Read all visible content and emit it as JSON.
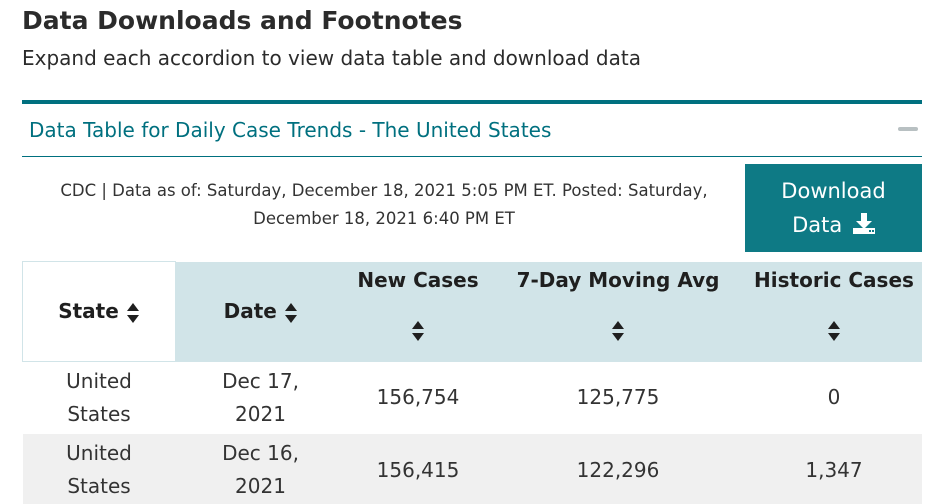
{
  "header": {
    "title": "Data Downloads and Footnotes",
    "subtitle": "Expand each accordion to view data table and download data"
  },
  "accordion": {
    "title": "Data Table for Daily Case Trends - The United States",
    "meta_line1": "CDC | Data as of: Saturday, December 18, 2021 5:05 PM ET. Posted: Saturday,",
    "meta_line2": "December 18, 2021 6:40 PM ET",
    "download_line1": "Download",
    "download_line2": "Data",
    "icons": {
      "collapse": "minus-icon",
      "download": "download-icon",
      "sort": "sort-icon"
    },
    "colors": {
      "accent": "#00707f",
      "button": "#0e7a85",
      "header_bg": "#d1e4e8",
      "alt_row_bg": "#f0f0f0"
    }
  },
  "table": {
    "columns": [
      "State",
      "Date",
      "New Cases",
      "7-Day Moving Avg",
      "Historic Cases"
    ],
    "rows": [
      {
        "state_1": "United",
        "state_2": "States",
        "date_1": "Dec 17,",
        "date_2": "2021",
        "new_cases": "156,754",
        "moving_avg": "125,775",
        "historic": "0"
      },
      {
        "state_1": "United",
        "state_2": "States",
        "date_1": "Dec 16,",
        "date_2": "2021",
        "new_cases": "156,415",
        "moving_avg": "122,296",
        "historic": "1,347"
      }
    ]
  }
}
